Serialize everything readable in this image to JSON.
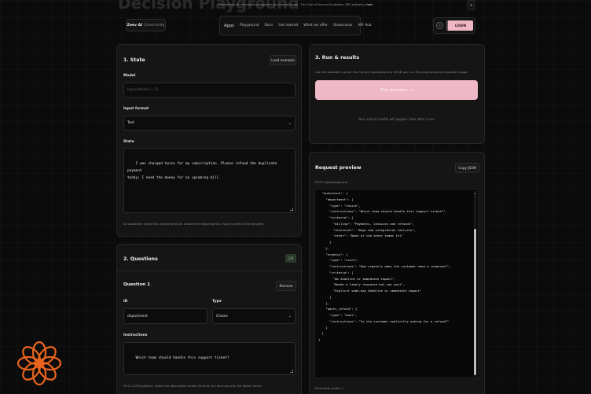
{
  "header": {
    "bg_title": "Decision Playground",
    "announcement": "Fundraising for the model playground and shared usage - Tick One of Force a Fundraiser. ORT activate a ",
    "announcement_link": "here",
    "close_label": "x",
    "brand_main": "Zeev AI",
    "brand_sub": "Community",
    "nav": [
      "Apps",
      "Playground",
      "Docs",
      "Get started",
      "What we offer",
      "Showcases",
      "API Hub"
    ],
    "theme_icon": "☼",
    "login_label": "LOGIN"
  },
  "state": {
    "title": "1. State",
    "load_example": "Load example",
    "model_label": "Model",
    "model_placeholder": "typesafe/zev-1.13",
    "format_label": "Input format",
    "format_value": "Text",
    "state_label": "State",
    "state_text": "I was charged twice for my subscription. Please refund the duplicate payment\ntoday; I need the money for an upcoming bill.",
    "hint": "All questions share this context and are answered independently. Input is sent to the provider."
  },
  "questions": {
    "title": "2. Questions",
    "count": "1/4",
    "q1_title": "Question 1",
    "remove": "Remove",
    "id_label": "ID",
    "id_value": "department",
    "type_label": "Type",
    "type_value": "Choice",
    "instructions_label": "Instructions",
    "instructions_value": "Which team should handle this support ticket?",
    "hint": "Fill in 2-255 options. Leave the description empty to send null and use only the option name."
  },
  "run": {
    "title": "3. Run & results",
    "desc": "Use the website's server key. Up to 8 questions and 32 KB per run. Running consumes provider usage.",
    "button": "Run decision →",
    "result_note": "Your actual results will appear here after a run."
  },
  "preview": {
    "title": "Request preview",
    "copy": "Copy JSON",
    "endpoint": "POST /api/playground",
    "footer": "Parameter guide →",
    "code_lines": [
      "  \"questions\": {",
      "    \"department\": {",
      "      \"type\": \"choice\",",
      "      \"instructions\": \"Which team should handle this support ticket?\",",
      "      \"criteria\": {",
      "        \"billing\": \"Payments, invoices and refunds\",",
      "        \"technical\": \"Bugs and integration failures\",",
      "        \"other\": \"None of the other teams fit\"",
      "      }",
      "    },",
      "    \"urgency\": {",
      "      \"type\": \"score\",",
      "      \"instructions\": \"How urgently does the customer need a response?\",",
      "      \"criteria\": [",
      "        \"No deadline or immediate impact\",",
      "        \"Needs a timely response but can wait\",",
      "        \"Explicit same-day deadline or immediate impact\"",
      "      ]",
      "    },",
      "    \"wants_refund\": {",
      "      \"type\": \"bool\",",
      "      \"instructions\": \"Is the customer explicitly asking for a refund?\"",
      "    }",
      "  }",
      "}"
    ]
  },
  "colors": {
    "accent": "#efb8c6",
    "logo": "#e8641e"
  }
}
